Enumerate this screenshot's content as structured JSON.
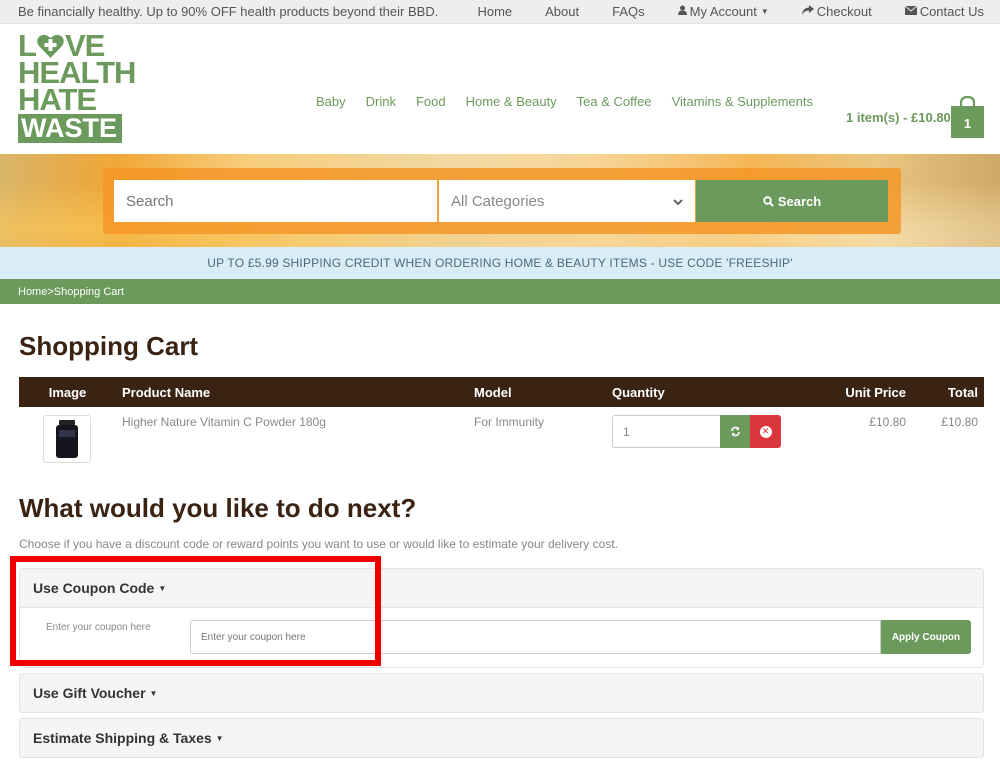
{
  "topbar": {
    "promo": "Be financially healthy. Up to 90% OFF health products beyond their BBD.",
    "links": [
      {
        "label": "Home",
        "icon": ""
      },
      {
        "label": "About",
        "icon": ""
      },
      {
        "label": "FAQs",
        "icon": ""
      },
      {
        "label": "My Account",
        "icon": "user-icon",
        "dropdown": true
      },
      {
        "label": "Checkout",
        "icon": "share-icon"
      },
      {
        "label": "Contact Us",
        "icon": "envelope-icon"
      }
    ]
  },
  "logo": {
    "line1a": "L",
    "line1b": "VE",
    "line2": "HEALTH",
    "line3": "HATE",
    "line4": "WASTE"
  },
  "nav": [
    "Baby",
    "Drink",
    "Food",
    "Home & Beauty",
    "Tea & Coffee",
    "Vitamins & Supplements"
  ],
  "cart_summary": {
    "text": "1 item(s) - £10.80",
    "badge": "1"
  },
  "search": {
    "placeholder": "Search",
    "category": "All Categories",
    "button": "Search"
  },
  "banner": "UP TO £5.99 SHIPPING CREDIT WHEN ORDERING HOME & BEAUTY ITEMS - USE CODE 'FREESHIP'",
  "breadcrumb": {
    "home": "Home",
    "sep": " > ",
    "current": "Shopping Cart"
  },
  "page_title": "Shopping Cart",
  "cart_table": {
    "headers": {
      "image": "Image",
      "name": "Product Name",
      "model": "Model",
      "quantity": "Quantity",
      "unit_price": "Unit Price",
      "total": "Total"
    },
    "rows": [
      {
        "name": "Higher Nature Vitamin C Powder 180g",
        "model": "For Immunity",
        "quantity": "1",
        "unit_price": "£10.80",
        "total": "£10.80"
      }
    ]
  },
  "next": {
    "title": "What would you like to do next?",
    "description": "Choose if you have a discount code or reward points you want to use or would like to estimate your delivery cost."
  },
  "coupon": {
    "title": "Use Coupon Code",
    "label": "Enter your coupon here",
    "placeholder": "Enter your coupon here",
    "button": "Apply Coupon"
  },
  "gift": {
    "title": "Use Gift Voucher"
  },
  "shipping": {
    "title": "Estimate Shipping & Taxes"
  },
  "colors": {
    "brand_green": "#6b9a5c",
    "dark_brown": "#3b2314",
    "remove_red": "#d9363e",
    "highlight": "#ee0000"
  }
}
